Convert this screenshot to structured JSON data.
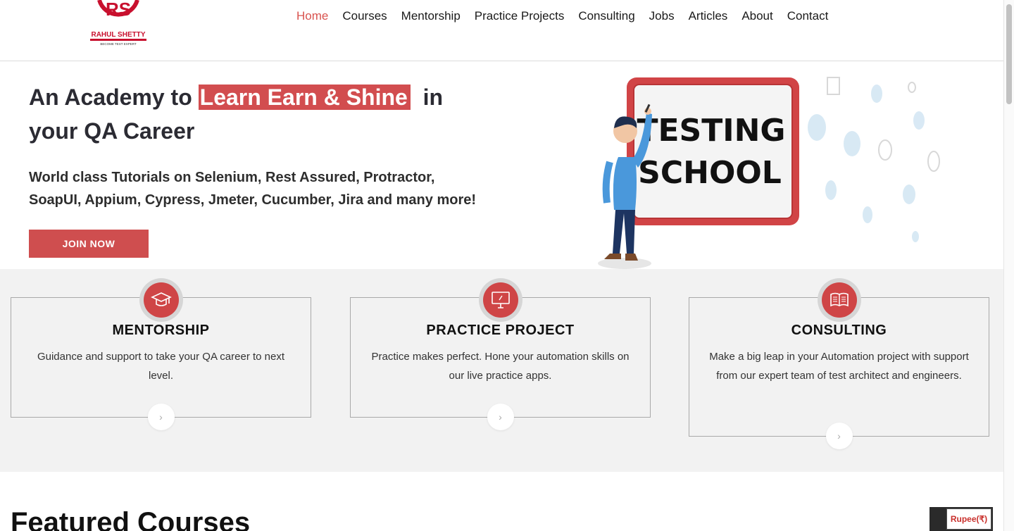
{
  "brand": {
    "logo_letters": "RS",
    "name": "RAHUL SHETTY",
    "tagline": "BECOME TEST EXPERT",
    "accent": "#d24d4f"
  },
  "nav": {
    "items": [
      {
        "label": "Home",
        "active": true
      },
      {
        "label": "Courses"
      },
      {
        "label": "Mentorship"
      },
      {
        "label": "Practice Projects"
      },
      {
        "label": "Consulting"
      },
      {
        "label": "Jobs"
      },
      {
        "label": "Articles"
      },
      {
        "label": "About"
      },
      {
        "label": "Contact"
      }
    ]
  },
  "hero": {
    "title_prefix": "An Academy to ",
    "title_highlight": "Learn Earn & Shine",
    "title_suffix": "  in your QA Career",
    "subtitle": "World class Tutorials on Selenium, Rest Assured, Protractor, SoapUI, Appium, Cypress, Jmeter, Cucumber, Jira and many more!",
    "cta_label": "JOIN NOW",
    "illustration_text_line1": "TESTING",
    "illustration_text_line2": "SCHOOL"
  },
  "features": [
    {
      "icon": "graduation-cap-icon",
      "title": "MENTORSHIP",
      "description": "Guidance and support to take your QA career to next level."
    },
    {
      "icon": "monitor-icon",
      "title": "PRACTICE PROJECT",
      "description": "Practice makes perfect. Hone your automation skills on our live practice apps."
    },
    {
      "icon": "book-icon",
      "title": "CONSULTING",
      "description": "Make a big leap in your Automation project with support from our expert team of test architect and engineers."
    }
  ],
  "featured": {
    "title": "Featured Courses"
  },
  "currency": {
    "label": "Rupee(₹)"
  }
}
